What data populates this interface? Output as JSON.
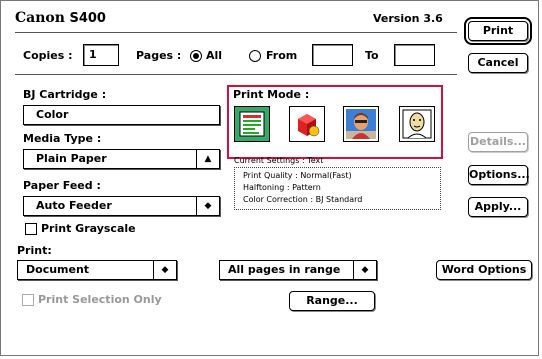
{
  "header": {
    "logo": "Canon",
    "model": "S400",
    "version": "Version 3.6"
  },
  "copies": {
    "label": "Copies :",
    "value": "1"
  },
  "pages": {
    "label": "Pages :",
    "all_label": "All",
    "from_label": "From",
    "to_label": "To",
    "from_value": "",
    "to_value": "",
    "selected": "All"
  },
  "buttons": {
    "print": "Print",
    "cancel": "Cancel",
    "details": "Details...",
    "options": "Options...",
    "apply": "Apply...",
    "word_options": "Word Options",
    "range": "Range..."
  },
  "cartridge": {
    "label": "BJ Cartridge :",
    "value": "Color"
  },
  "media": {
    "label": "Media Type :",
    "value": "Plain Paper"
  },
  "paperfeed": {
    "label": "Paper Feed :",
    "value": "Auto Feeder"
  },
  "grayscale": {
    "label": "Print Grayscale",
    "checked": false
  },
  "printmode": {
    "label": "Print Mode :",
    "modes": [
      {
        "icon": "text-document-icon",
        "selected": true
      },
      {
        "icon": "3d-graphics-icon",
        "selected": false
      },
      {
        "icon": "photo-icon",
        "selected": false
      },
      {
        "icon": "custom-person-icon",
        "selected": false
      }
    ],
    "current": "Current Settings : Text",
    "settings": [
      "Print Quality : Normal(Fast)",
      "Halftoning : Pattern",
      "Color Correction : BJ Standard"
    ]
  },
  "print": {
    "label": "Print:",
    "source_value": "Document",
    "range_value": "All pages in range"
  },
  "selection_only": {
    "label": "Print Selection Only",
    "checked": false
  },
  "colors": {
    "accent_box": "#d40f3f",
    "disabled_text": "#999999"
  }
}
